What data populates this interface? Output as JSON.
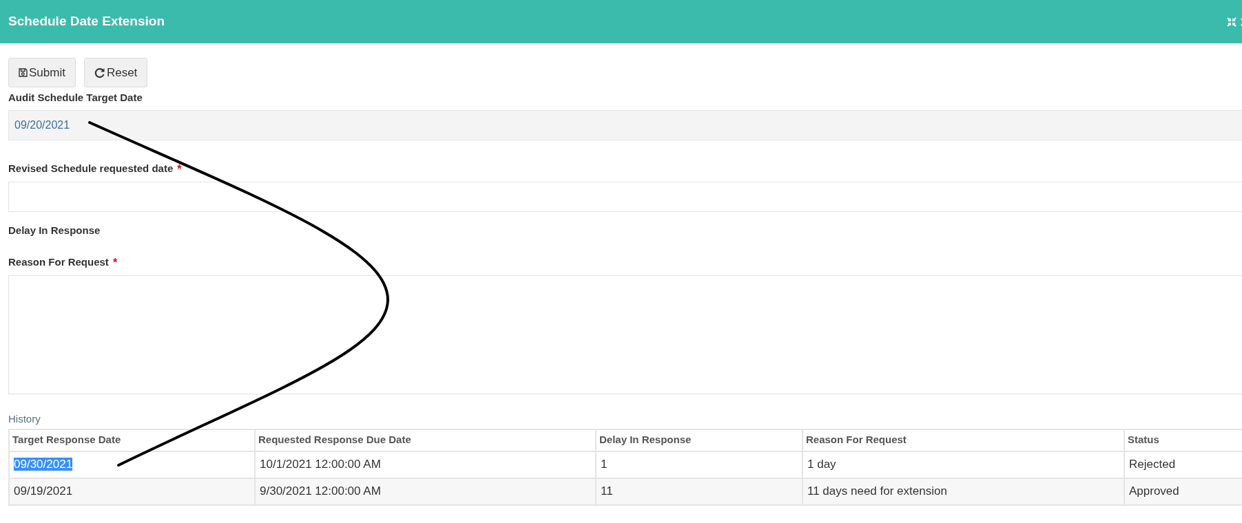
{
  "dialog": {
    "title": "Schedule Date Extension"
  },
  "buttons": [
    {
      "label": "Submit",
      "kind": "save"
    },
    {
      "label": "Reset",
      "kind": "reset"
    }
  ],
  "fields": [
    {
      "kind": "readonly_input",
      "label": "Audit Schedule Target Date",
      "value": "09/20/2021"
    },
    {
      "kind": "input",
      "label": "Revised Schedule requested date",
      "required_mark": "*"
    },
    {
      "kind": "label",
      "label": "Delay In Response"
    },
    {
      "kind": "textarea",
      "label": "Reason For Request",
      "required_mark": "*"
    }
  ],
  "history": {
    "caption": "History",
    "columns": [
      "Target Response Date",
      "Requested Response Due Date",
      "Delay In Response",
      "Reason For Request",
      "Status"
    ],
    "rows": [
      {
        "cells": [
          "09/30/2021",
          "10/1/2021 12:00:00 AM",
          "1",
          "1 day",
          "Rejected"
        ],
        "first_cell_highlighted": true
      },
      {
        "cells": [
          "09/19/2021",
          "9/30/2021 12:00:00 AM",
          "11",
          "11 days need for extension",
          "Approved"
        ],
        "first_cell_highlighted": false
      }
    ]
  }
}
